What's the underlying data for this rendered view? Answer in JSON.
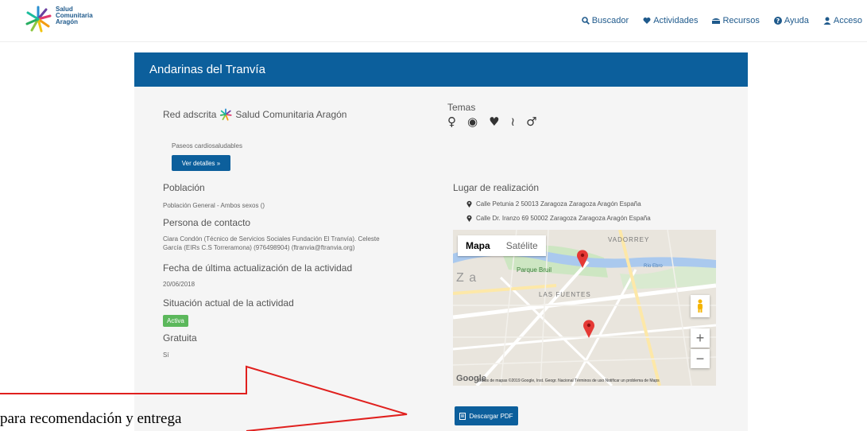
{
  "header": {
    "logo": {
      "line1": "Salud",
      "line2": "Comunitaria",
      "line3": "Aragón"
    },
    "nav": [
      {
        "label": "Buscador",
        "icon": "search-icon"
      },
      {
        "label": "Actividades",
        "icon": "heart-icon"
      },
      {
        "label": "Recursos",
        "icon": "folder-icon"
      },
      {
        "label": "Ayuda",
        "icon": "question-icon"
      },
      {
        "label": "Acceso",
        "icon": "user-icon"
      }
    ]
  },
  "panel": {
    "title": "Andarinas del Tranvía",
    "red": {
      "label": "Red adscrita",
      "name": "Salud Comunitaria Aragón"
    },
    "temas": {
      "label": "Temas",
      "icons": [
        "♀",
        "◉",
        "♥",
        "≀",
        "♂"
      ]
    },
    "activity": "Paseos cardiosaludables",
    "details_button": "Ver detalles »",
    "poblacion": {
      "label": "Población",
      "value": "Población General - Ambos sexos ()"
    },
    "contacto": {
      "label": "Persona de contacto",
      "value_line1": "Ciara Condón (Técnico de Servicios Sociales Fundación El Tranvía). Celeste",
      "value_line2": "García (EIRs C.S Torreramona) (976498904) (ftranvia@ftranvia.org)"
    },
    "fecha": {
      "label": "Fecha de última actualización de la actividad",
      "value": "20/06/2018"
    },
    "situacion": {
      "label": "Situación actual de la actividad",
      "value": "Activa"
    },
    "gratuita": {
      "label": "Gratuita",
      "value": "Sí"
    },
    "lugar": {
      "label": "Lugar de realización",
      "addresses": [
        "Calle Petunia 2 50013 Zaragoza Zaragoza Aragón España",
        "Calle Dr. Iranzo 69 50002 Zaragoza Zaragoza Aragón España"
      ]
    },
    "map": {
      "tab_map": "Mapa",
      "tab_sat": "Satélite",
      "labels": {
        "vadorrey": "VADORREY",
        "fuentes": "LAS FUENTES",
        "parque": "Parque Bruil",
        "za": "Z a",
        "rioebro": "Río Ebro"
      },
      "google": "Google",
      "footer": "Datos de mapas ©2019 Google, Inst. Geogr. Nacional   Términos de uso   Notificar un problema de Maps",
      "zoom_in": "+",
      "zoom_out": "−"
    },
    "pdf_button": "Descargar PDF"
  },
  "annotation": {
    "text": "para recomendación y entrega"
  }
}
